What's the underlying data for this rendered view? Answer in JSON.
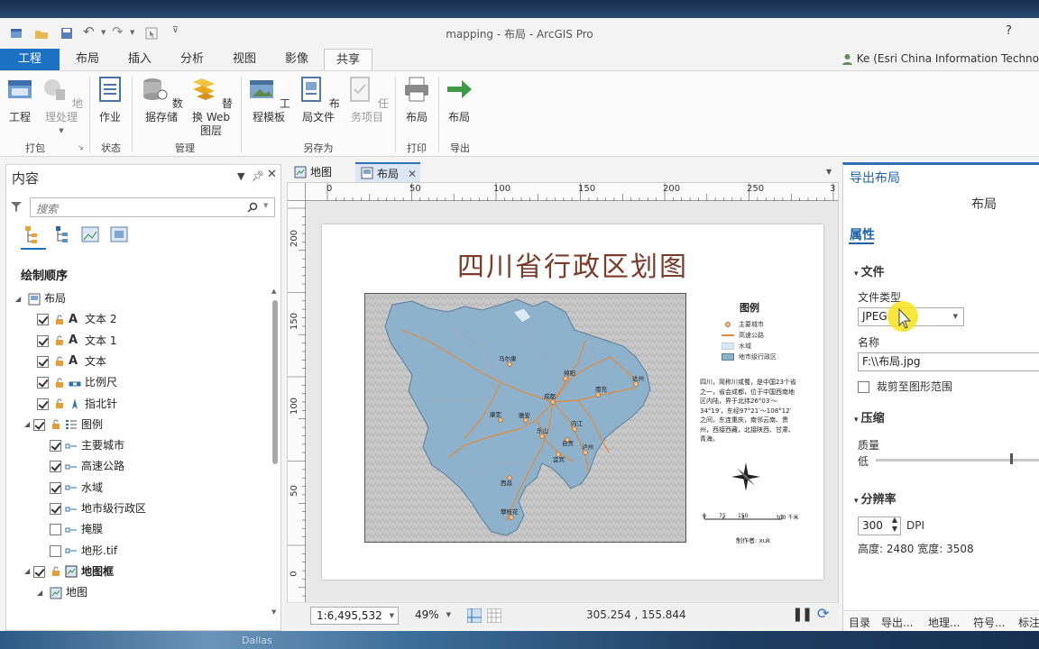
{
  "app": {
    "title": "mapping - 布局 - ArcGIS Pro",
    "help": "?",
    "user": "Ke (Esri China Information Techno"
  },
  "tabs": [
    "工程",
    "布局",
    "插入",
    "分析",
    "视图",
    "影像",
    "共享"
  ],
  "ribbon": {
    "buttons": {
      "project": "工程",
      "geoprocessing": "地理处理",
      "job": "作业",
      "data_store": "数据存储",
      "replace_web_layer_1": "替换 Web",
      "replace_web_layer_2": "图层",
      "project_template": "工程模板",
      "layout_file": "布局文件",
      "task_item": "任务项目",
      "print_layout": "布局",
      "export_layout": "布局"
    },
    "groups": {
      "package": "打包",
      "status": "状态",
      "manage": "管理",
      "save_as": "另存为",
      "print": "打印",
      "export": "导出"
    }
  },
  "contents": {
    "title": "内容",
    "search_placeholder": "搜索",
    "heading": "绘制顺序",
    "tree": [
      {
        "label": "布局",
        "checked": null
      },
      {
        "label": "文本 2",
        "checked": true
      },
      {
        "label": "文本 1",
        "checked": true
      },
      {
        "label": "文本",
        "checked": true
      },
      {
        "label": "比例尺",
        "checked": true
      },
      {
        "label": "指北针",
        "checked": true
      },
      {
        "label": "图例",
        "checked": true
      },
      {
        "label": "主要城市",
        "checked": true
      },
      {
        "label": "高速公路",
        "checked": true
      },
      {
        "label": "水域",
        "checked": true
      },
      {
        "label": "地市级行政区",
        "checked": true
      },
      {
        "label": "掩膜",
        "checked": false
      },
      {
        "label": "地形.tif",
        "checked": false
      },
      {
        "label": "地图框",
        "checked": true
      },
      {
        "label": "地图",
        "checked": null
      }
    ]
  },
  "view_tabs": {
    "map": "地图",
    "layout": "布局"
  },
  "rulers": {
    "h": [
      "0",
      "50",
      "100",
      "150",
      "200",
      "250",
      "3"
    ],
    "v": [
      "200",
      "150",
      "100",
      "50",
      "0"
    ]
  },
  "layout": {
    "title": "四川省行政区划图",
    "legend_title": "图例",
    "legend_items": [
      "主要城市",
      "高速公路",
      "水域",
      "地市级行政区"
    ],
    "description": "四川，简称川或蜀，是中国23个省之一，省会成都，位于中国西南地区内陆，界于北纬26°03′～34°19′，东经97°21′～108°12′之间，东连重庆，南邻云南、贵州，西接西藏，北接陕西、甘肃、青海。",
    "scale_labels": [
      "0",
      "75",
      "150",
      "300 千米"
    ],
    "author": "制作者:  xuk",
    "cities": [
      "马尔康",
      "绵阳",
      "南充",
      "达州",
      "成都",
      "康定",
      "雅安",
      "乐山",
      "内江",
      "自贡",
      "宜宾",
      "泸州",
      "西昌",
      "攀枝花"
    ]
  },
  "statusbar": {
    "scale": "1:6,495,532",
    "zoom": "49%",
    "coords": "305.254 , 155.844"
  },
  "export": {
    "title": "导出布局",
    "subtitle": "布局",
    "properties_tab": "属性",
    "file_section": "文件",
    "file_type_label": "文件类型",
    "file_type_value": "JPEG",
    "name_label": "名称",
    "name_value": "F:\\\\布局.jpg",
    "clip_label": "裁剪至图形范围",
    "compression_section": "压缩",
    "quality_label": "质量",
    "quality_low": "低",
    "quality_level": 0.9,
    "resolution_section": "分辨率",
    "dpi_value": "300",
    "dpi_unit": "DPI",
    "size_text": "高度: 2480 宽度: 3508",
    "bottom_tabs": [
      "目录",
      "导出...",
      "地理...",
      "符号...",
      "标注"
    ]
  },
  "taskbar": {
    "label": "Dallas"
  },
  "colors": {
    "accent": "#1c71c4",
    "title_text": "#7b3b2b",
    "province_fill": "#8fb2cc",
    "highway": "#e08a3c"
  }
}
